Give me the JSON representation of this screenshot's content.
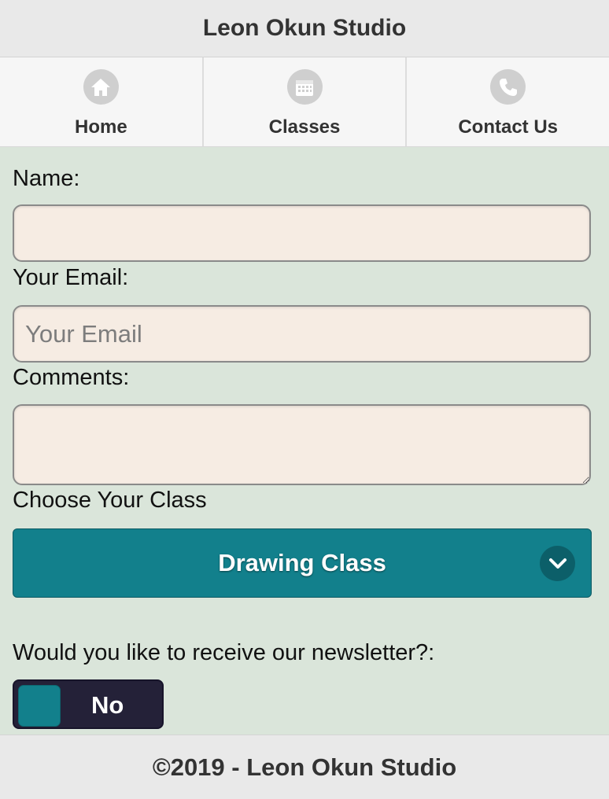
{
  "header": {
    "title": "Leon Okun Studio"
  },
  "nav": {
    "items": [
      {
        "label": "Home",
        "icon": "home-icon"
      },
      {
        "label": "Classes",
        "icon": "calendar-icon"
      },
      {
        "label": "Contact Us",
        "icon": "phone-icon"
      }
    ]
  },
  "form": {
    "name_label": "Name:",
    "name_value": "",
    "email_label": "Your Email:",
    "email_placeholder": "Your Email",
    "comments_label": "Comments:",
    "class_label": "Choose Your Class",
    "class_selected": "Drawing Class",
    "newsletter_label": "Would you like to receive our newsletter?:",
    "newsletter_value": "No"
  },
  "footer": {
    "text": "©2019 - Leon Okun Studio"
  },
  "colors": {
    "accent": "#12808c",
    "input_bg": "#f6ece3",
    "page_bg": "#dae5da",
    "toggle_bg": "#242138"
  }
}
